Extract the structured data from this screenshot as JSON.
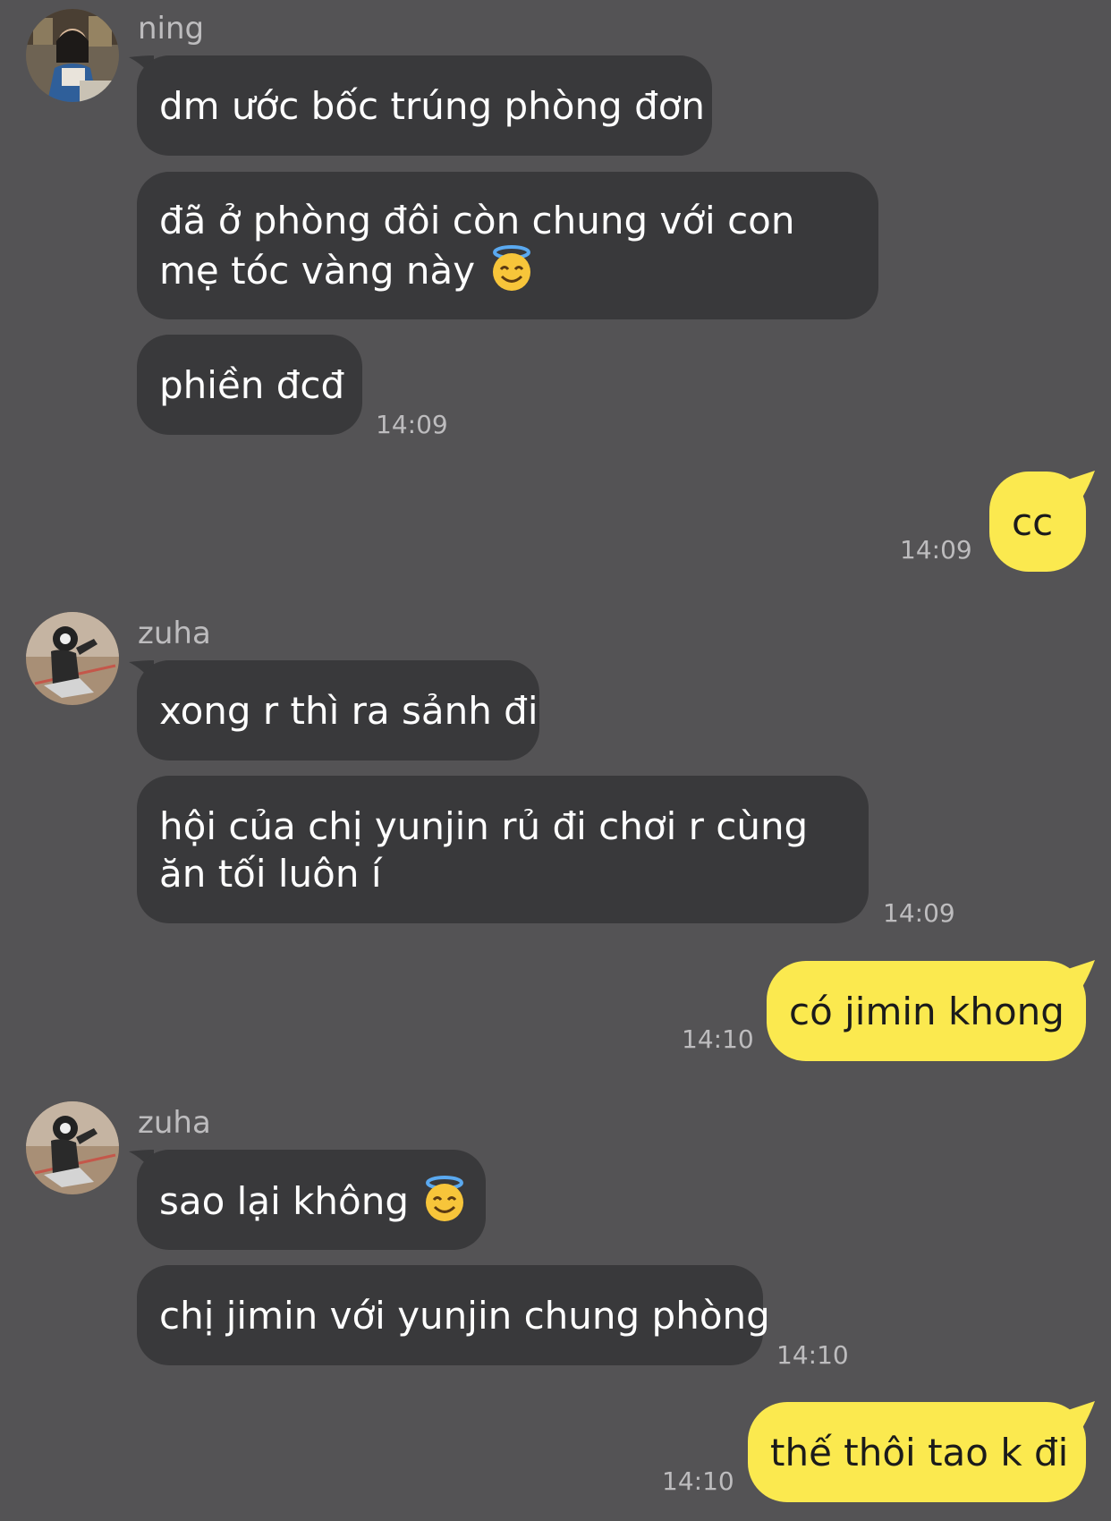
{
  "messages": [
    {
      "sender": "ning",
      "bubbles": [
        "dm ước bốc trúng phòng đơn",
        "đã ở phòng đôi còn chung với con mẹ tóc vàng này",
        "phiền đcđ"
      ],
      "time": "14:09"
    },
    {
      "sender": "me",
      "bubbles": [
        "cc"
      ],
      "time": "14:09"
    },
    {
      "sender": "zuha",
      "bubbles": [
        "xong r thì ra sảnh đi",
        "hội của chị yunjin rủ đi chơi r cùng ăn tối luôn í"
      ],
      "time": "14:09"
    },
    {
      "sender": "me",
      "bubbles": [
        "có jimin khong"
      ],
      "time": "14:10"
    },
    {
      "sender": "zuha",
      "bubbles": [
        "sao lại không",
        "chị jimin với yunjin chung phòng"
      ],
      "time": "14:10"
    },
    {
      "sender": "me",
      "bubbles": [
        "thế thôi tao k đi"
      ],
      "time": "14:10"
    }
  ],
  "emoji": {
    "halo": "smiling-face-with-halo"
  },
  "colors": {
    "background": "#545355",
    "incoming_bubble": "#39393b",
    "outgoing_bubble": "#fbe94f",
    "meta_text": "#bdbcbe"
  }
}
